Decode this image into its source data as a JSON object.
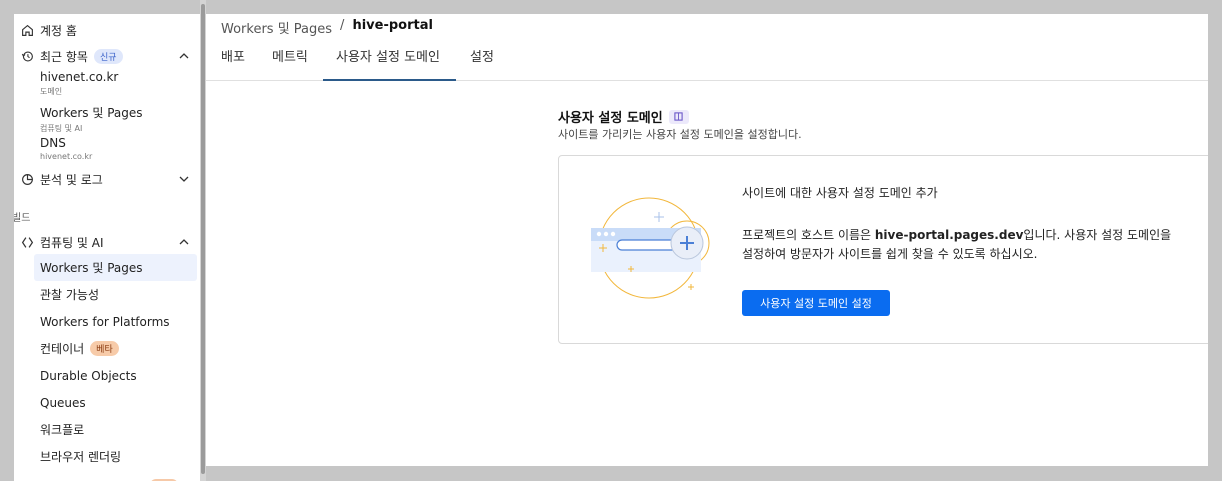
{
  "sidebar": {
    "home_label": "계정 홈",
    "recent_label": "최근 항목",
    "recent_badge": "신규",
    "recent_items": [
      {
        "name": "hivenet.co.kr",
        "sub": "도메인"
      },
      {
        "name": "Workers 및 Pages",
        "sub": "컴퓨팅 및 AI"
      },
      {
        "name": "DNS",
        "sub": "hivenet.co.kr"
      }
    ],
    "analytics_label": "분석 및 로그",
    "build_section": "빌드",
    "compute_label": "컴퓨팅 및 AI",
    "compute_items": [
      "Workers 및 Pages",
      "관찰 가능성",
      "Workers for Platforms",
      "컨테이너",
      "Durable Objects",
      "Queues",
      "워크플로",
      "브라우저 렌더링"
    ],
    "beta_badge": "베타"
  },
  "breadcrumb": {
    "parent": "Workers 및 Pages",
    "separator": "/",
    "current": "hive-portal"
  },
  "tabs": [
    "배포",
    "메트릭",
    "사용자 설정 도메인",
    "설정"
  ],
  "active_tab": "사용자 설정 도메인",
  "panel": {
    "title": "사용자 설정 도메인",
    "description": "사이트를 가리키는 사용자 설정 도메인을 설정합니다.",
    "card_heading": "사이트에 대한 사용자 설정 도메인 추가",
    "body_prefix": "프로젝트의 호스트 이름은 ",
    "hostname": "hive-portal.pages.dev",
    "body_suffix": "입니다. 사용자 설정 도메인을 설정하여 방문자가 사이트를 쉽게 찾을 수 있도록 하십시오.",
    "button_label": "사용자 설정 도메인 설정"
  },
  "colors": {
    "accent": "#0a6cf0",
    "active_tab_underline": "#2b5a8a",
    "nav_active_bg": "#edf2fd",
    "illustration_orange": "#f2b73c",
    "illustration_blue": "#4a7fd6"
  }
}
